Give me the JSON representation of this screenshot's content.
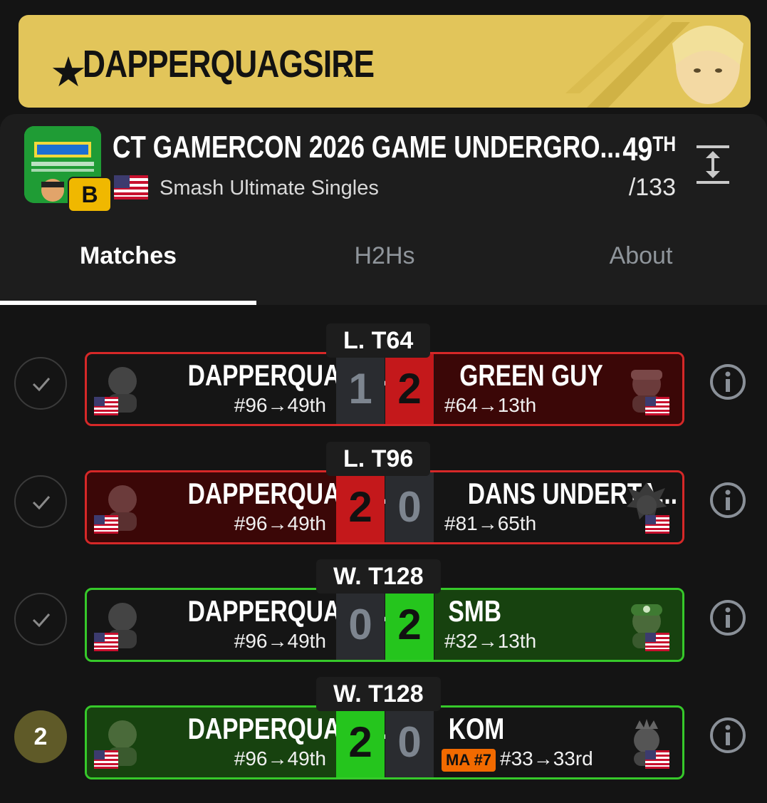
{
  "banner": {
    "player": "DAPPERQUAGSIRE",
    "star": "★",
    "chevron": "›"
  },
  "event": {
    "title": "CT GAMERCON 2026 GAME UNDERGRO...",
    "tier": "B",
    "game": "Smash Ultimate Singles",
    "placement": "49",
    "placement_suffix": "TH",
    "total": "/133"
  },
  "tabs": {
    "matches": "Matches",
    "h2h": "H2Hs",
    "about": "About"
  },
  "matches": [
    {
      "round": "L. T64",
      "status": "check",
      "left": {
        "name": "DAPPERQUAGSI...",
        "seed": "#96→49th",
        "score": "1"
      },
      "right": {
        "name": "GREEN GUY",
        "seed": "#64→13th",
        "score": "2"
      }
    },
    {
      "round": "L. T96",
      "status": "check",
      "left": {
        "name": "DAPPERQUAGSI...",
        "seed": "#96→49th",
        "score": "2"
      },
      "right": {
        "name": "DANS UNDERTA...",
        "seed": "#81→65th",
        "score": "0"
      }
    },
    {
      "round": "W. T128",
      "status": "check",
      "left": {
        "name": "DAPPERQUAGSI...",
        "seed": "#96→49th",
        "score": "0"
      },
      "right": {
        "name": "SMB",
        "seed": "#32→13th",
        "score": "2"
      }
    },
    {
      "round": "W. T128",
      "status": "2",
      "left": {
        "name": "DAPPERQUAGSI...",
        "seed": "#96→49th",
        "score": "2"
      },
      "right": {
        "name": "KOM",
        "seed": "#33→33rd",
        "score": "0",
        "badge": "MA #7"
      }
    }
  ],
  "colors": {
    "gold": "#e2c55a",
    "win": "#25c51d",
    "loss": "#c4181b",
    "tier": "#f0b800",
    "badge": "#f26a00"
  }
}
